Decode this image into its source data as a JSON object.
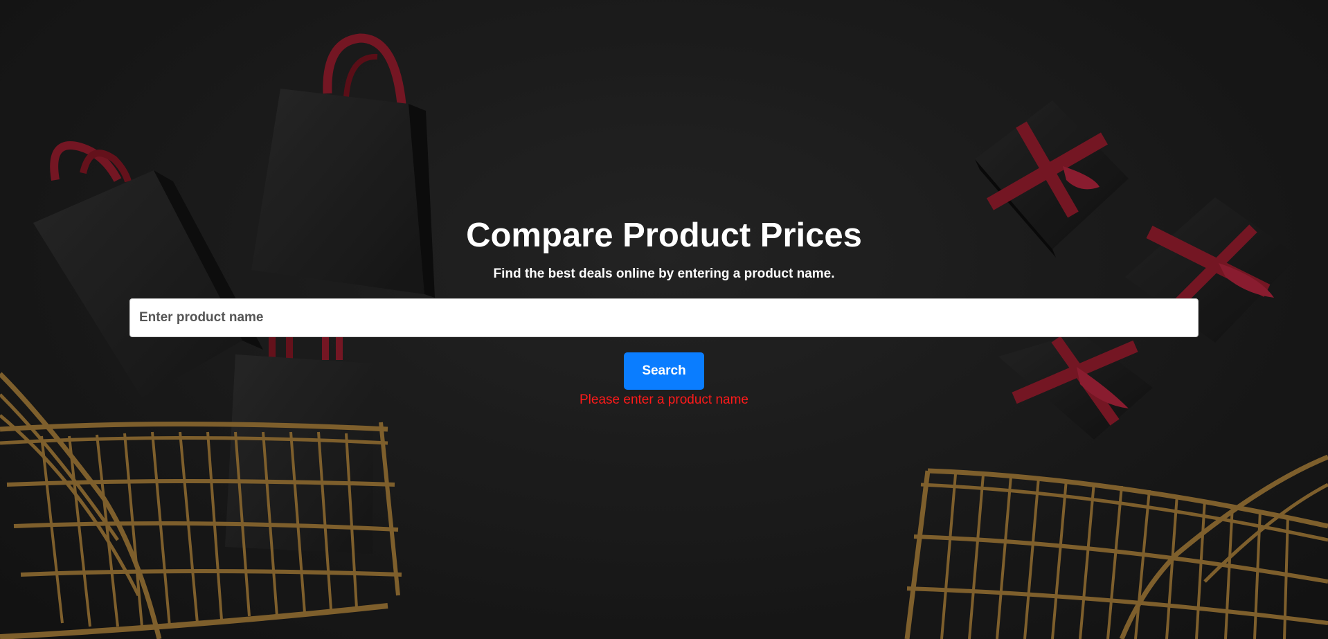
{
  "hero": {
    "title": "Compare Product Prices",
    "subtitle": "Find the best deals online by entering a product name."
  },
  "search": {
    "placeholder": "Enter product name",
    "value": "",
    "button_label": "Search",
    "error": "Please enter a product name"
  },
  "colors": {
    "accent": "#0a7dff",
    "error": "#ff1a1a",
    "background": "#1c1c1c",
    "ribbon": "#8e1c2b",
    "cart_gold": "#9a7436"
  },
  "background_image": {
    "objects": [
      "shopping-bag",
      "shopping-bag",
      "shopping-bag",
      "gift-box",
      "gift-box",
      "gift-box",
      "shopping-cart",
      "shopping-cart"
    ]
  }
}
